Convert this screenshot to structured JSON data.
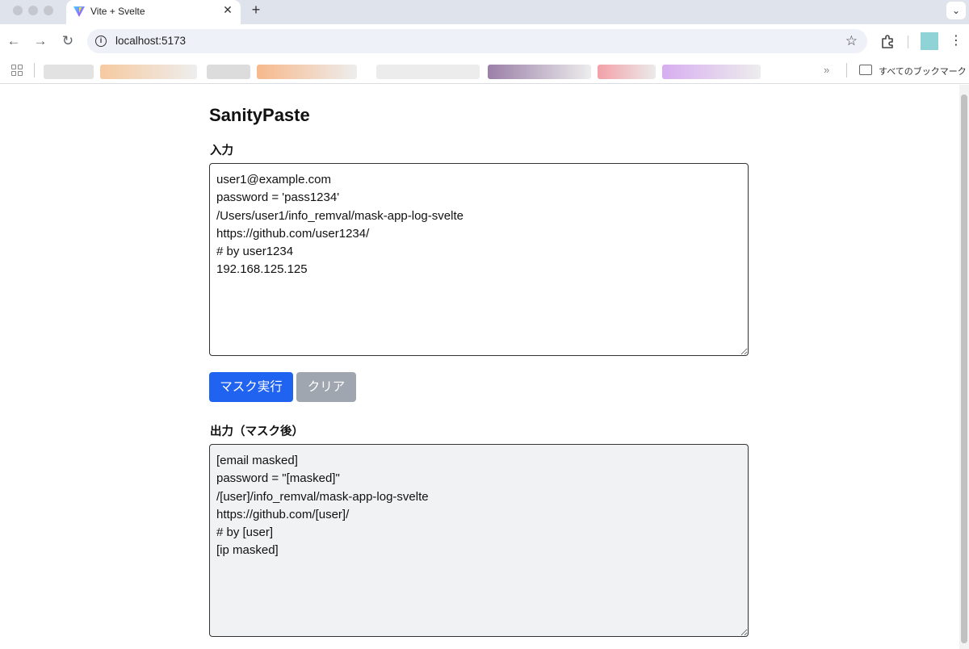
{
  "browser": {
    "tab": {
      "title": "Vite + Svelte",
      "close_glyph": "✕"
    },
    "new_tab_glyph": "+",
    "tab_menu_glyph": "⌄",
    "nav": {
      "back_glyph": "←",
      "forward_glyph": "→",
      "reload_glyph": "↻"
    },
    "url": "localhost:5173",
    "bookmarks": {
      "overflow_glyph": "»",
      "all_bookmarks_label": "すべてのブックマーク"
    }
  },
  "page": {
    "title": "SanityPaste",
    "input": {
      "label": "入力",
      "value": "user1@example.com\npassword = 'pass1234'\n/Users/user1/info_remval/mask-app-log-svelte\nhttps://github.com/user1234/\n# by user1234\n192.168.125.125"
    },
    "buttons": {
      "mask_label": "マスク実行",
      "clear_label": "クリア",
      "mask_color": "#1f63f0",
      "clear_color": "#a0a6b0"
    },
    "output": {
      "label": "出力（マスク後）",
      "value": "[email masked]\npassword = \"[masked]\"\n/[user]/info_remval/mask-app-log-svelte\nhttps://github.com/[user]/\n# by [user]\n[ip masked]"
    }
  }
}
